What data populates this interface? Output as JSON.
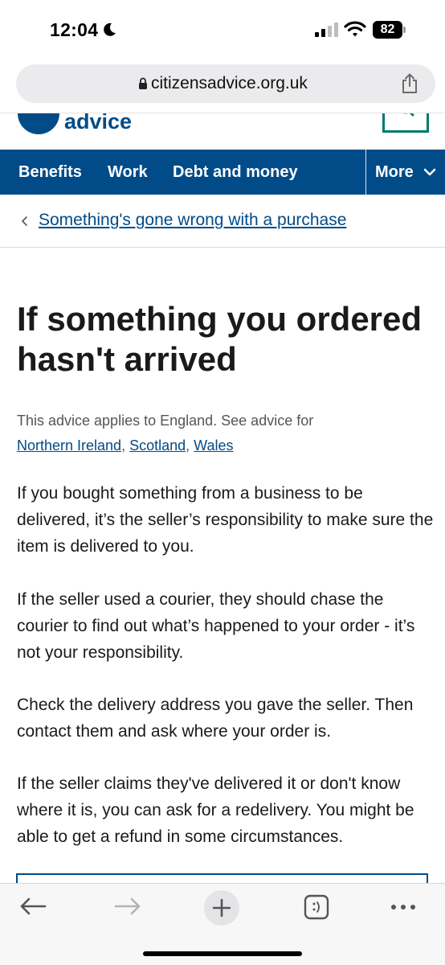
{
  "status_bar": {
    "time": "12:04",
    "battery": "82"
  },
  "browser": {
    "url": "citizensadvice.org.uk"
  },
  "header": {
    "logo_text": "advice"
  },
  "nav": {
    "items": [
      "Benefits",
      "Work",
      "Debt and money"
    ],
    "more_label": "More"
  },
  "breadcrumb": {
    "link": "Something's gone wrong with a purchase"
  },
  "main": {
    "title": "If something you ordered hasn't arrived",
    "applies_text": "This advice applies to England. See advice for",
    "regions": [
      "Northern Ireland",
      "Scotland",
      "Wales"
    ],
    "paragraphs": [
      "If you bought something from a business to be delivered, it’s the seller’s responsibility to make sure the item is delivered to you.",
      "If the seller used a courier, they should chase the courier to find out what’s happened to your order - it’s not your responsibility.",
      "Check the delivery address you gave the seller. Then contact them and ask where your order is.",
      "If the seller claims they've delivered it or don't know where it is, you can ask for a redelivery. You might be able to get a refund in some circumstances."
    ]
  },
  "colors": {
    "brand_blue": "#004b88",
    "accent_green": "#007a6c"
  }
}
